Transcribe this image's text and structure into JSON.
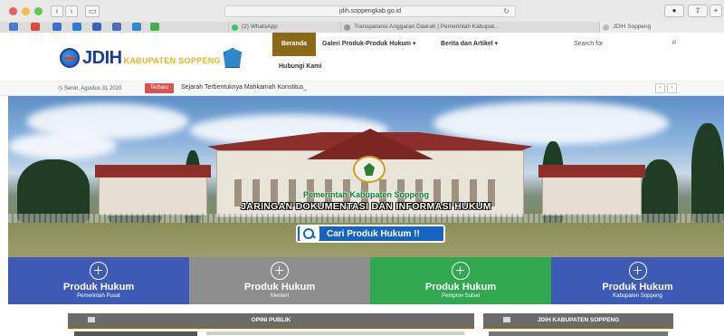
{
  "browser": {
    "url": "jdih.soppengkab.go.id",
    "tabs": [
      {
        "label": "(2) WhatsApp"
      },
      {
        "label": "Transparansi Anggaran Daerah | Pemerintah Kabupat..."
      },
      {
        "label": "JDIH Soppeng"
      }
    ]
  },
  "site": {
    "logo_text": "JDIH",
    "logo_sub": "KABUPATEN SOPPENG",
    "nav": {
      "active": "Beranda",
      "items": [
        "Galeri Produk-Produk Hukum ▾",
        "Berita dan Artikel ▾"
      ],
      "second_row": "Hubungi Kami"
    },
    "search_placeholder": "Search for"
  },
  "ticker": {
    "date": "Senin, Agustus 31 2020",
    "badge": "Terbaru",
    "headline": "Sejarah Terbentuknya Mahkamah Konstitus_"
  },
  "hero": {
    "subtitle": "Pemerintah Kabupaten Soppeng",
    "title": "JARINGAN DOKUMENTASI DAN INFORMASI HUKUM",
    "button_label": "Cari Produk Hukum !!"
  },
  "categories": [
    {
      "title": "Produk Hukum",
      "sub": "Pemerintah Pusat",
      "color": "#3d5bb5"
    },
    {
      "title": "Produk Hukum",
      "sub": "Menteri",
      "color": "#8e8e8e"
    },
    {
      "title": "Produk Hukum",
      "sub": "Pemprov Sulsel",
      "color": "#2fa84f"
    },
    {
      "title": "Produk Hukum",
      "sub": "Kabupaten Soppeng",
      "color": "#3d5bb5"
    }
  ],
  "panels": {
    "opini": "OPINI PUBLIK",
    "jdih": "JDIH KABUPATEN SOPPENG"
  }
}
